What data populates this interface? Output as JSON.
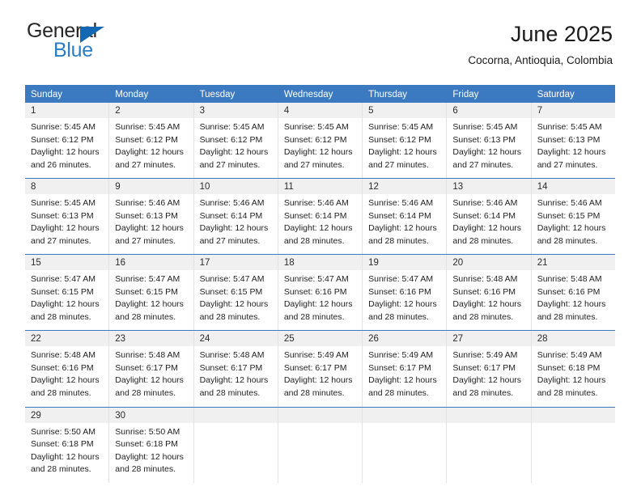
{
  "brand": {
    "name_top": "General",
    "name_bottom": "Blue",
    "triangle_icon": "triangle-logo-icon",
    "color_dark": "#262626",
    "color_blue": "#2a7dc4"
  },
  "header": {
    "title": "June 2025",
    "subtitle": "Cocorna, Antioquia, Colombia"
  },
  "theme": {
    "header_bg": "#3b7ac0",
    "header_text": "#ffffff",
    "daynum_bg": "#f0f0f0",
    "cell_bg": "#ffffff",
    "grid_line": "#e2e2e2",
    "week_divider": "#3b7ac0"
  },
  "calendar": {
    "weekdays": [
      "Sunday",
      "Monday",
      "Tuesday",
      "Wednesday",
      "Thursday",
      "Friday",
      "Saturday"
    ],
    "weeks": [
      {
        "days": [
          {
            "date": "1",
            "sunrise": "Sunrise: 5:45 AM",
            "sunset": "Sunset: 6:12 PM",
            "daylight_1": "Daylight: 12 hours",
            "daylight_2": "and 26 minutes."
          },
          {
            "date": "2",
            "sunrise": "Sunrise: 5:45 AM",
            "sunset": "Sunset: 6:12 PM",
            "daylight_1": "Daylight: 12 hours",
            "daylight_2": "and 27 minutes."
          },
          {
            "date": "3",
            "sunrise": "Sunrise: 5:45 AM",
            "sunset": "Sunset: 6:12 PM",
            "daylight_1": "Daylight: 12 hours",
            "daylight_2": "and 27 minutes."
          },
          {
            "date": "4",
            "sunrise": "Sunrise: 5:45 AM",
            "sunset": "Sunset: 6:12 PM",
            "daylight_1": "Daylight: 12 hours",
            "daylight_2": "and 27 minutes."
          },
          {
            "date": "5",
            "sunrise": "Sunrise: 5:45 AM",
            "sunset": "Sunset: 6:12 PM",
            "daylight_1": "Daylight: 12 hours",
            "daylight_2": "and 27 minutes."
          },
          {
            "date": "6",
            "sunrise": "Sunrise: 5:45 AM",
            "sunset": "Sunset: 6:13 PM",
            "daylight_1": "Daylight: 12 hours",
            "daylight_2": "and 27 minutes."
          },
          {
            "date": "7",
            "sunrise": "Sunrise: 5:45 AM",
            "sunset": "Sunset: 6:13 PM",
            "daylight_1": "Daylight: 12 hours",
            "daylight_2": "and 27 minutes."
          }
        ]
      },
      {
        "days": [
          {
            "date": "8",
            "sunrise": "Sunrise: 5:45 AM",
            "sunset": "Sunset: 6:13 PM",
            "daylight_1": "Daylight: 12 hours",
            "daylight_2": "and 27 minutes."
          },
          {
            "date": "9",
            "sunrise": "Sunrise: 5:46 AM",
            "sunset": "Sunset: 6:13 PM",
            "daylight_1": "Daylight: 12 hours",
            "daylight_2": "and 27 minutes."
          },
          {
            "date": "10",
            "sunrise": "Sunrise: 5:46 AM",
            "sunset": "Sunset: 6:14 PM",
            "daylight_1": "Daylight: 12 hours",
            "daylight_2": "and 27 minutes."
          },
          {
            "date": "11",
            "sunrise": "Sunrise: 5:46 AM",
            "sunset": "Sunset: 6:14 PM",
            "daylight_1": "Daylight: 12 hours",
            "daylight_2": "and 28 minutes."
          },
          {
            "date": "12",
            "sunrise": "Sunrise: 5:46 AM",
            "sunset": "Sunset: 6:14 PM",
            "daylight_1": "Daylight: 12 hours",
            "daylight_2": "and 28 minutes."
          },
          {
            "date": "13",
            "sunrise": "Sunrise: 5:46 AM",
            "sunset": "Sunset: 6:14 PM",
            "daylight_1": "Daylight: 12 hours",
            "daylight_2": "and 28 minutes."
          },
          {
            "date": "14",
            "sunrise": "Sunrise: 5:46 AM",
            "sunset": "Sunset: 6:15 PM",
            "daylight_1": "Daylight: 12 hours",
            "daylight_2": "and 28 minutes."
          }
        ]
      },
      {
        "days": [
          {
            "date": "15",
            "sunrise": "Sunrise: 5:47 AM",
            "sunset": "Sunset: 6:15 PM",
            "daylight_1": "Daylight: 12 hours",
            "daylight_2": "and 28 minutes."
          },
          {
            "date": "16",
            "sunrise": "Sunrise: 5:47 AM",
            "sunset": "Sunset: 6:15 PM",
            "daylight_1": "Daylight: 12 hours",
            "daylight_2": "and 28 minutes."
          },
          {
            "date": "17",
            "sunrise": "Sunrise: 5:47 AM",
            "sunset": "Sunset: 6:15 PM",
            "daylight_1": "Daylight: 12 hours",
            "daylight_2": "and 28 minutes."
          },
          {
            "date": "18",
            "sunrise": "Sunrise: 5:47 AM",
            "sunset": "Sunset: 6:16 PM",
            "daylight_1": "Daylight: 12 hours",
            "daylight_2": "and 28 minutes."
          },
          {
            "date": "19",
            "sunrise": "Sunrise: 5:47 AM",
            "sunset": "Sunset: 6:16 PM",
            "daylight_1": "Daylight: 12 hours",
            "daylight_2": "and 28 minutes."
          },
          {
            "date": "20",
            "sunrise": "Sunrise: 5:48 AM",
            "sunset": "Sunset: 6:16 PM",
            "daylight_1": "Daylight: 12 hours",
            "daylight_2": "and 28 minutes."
          },
          {
            "date": "21",
            "sunrise": "Sunrise: 5:48 AM",
            "sunset": "Sunset: 6:16 PM",
            "daylight_1": "Daylight: 12 hours",
            "daylight_2": "and 28 minutes."
          }
        ]
      },
      {
        "days": [
          {
            "date": "22",
            "sunrise": "Sunrise: 5:48 AM",
            "sunset": "Sunset: 6:16 PM",
            "daylight_1": "Daylight: 12 hours",
            "daylight_2": "and 28 minutes."
          },
          {
            "date": "23",
            "sunrise": "Sunrise: 5:48 AM",
            "sunset": "Sunset: 6:17 PM",
            "daylight_1": "Daylight: 12 hours",
            "daylight_2": "and 28 minutes."
          },
          {
            "date": "24",
            "sunrise": "Sunrise: 5:48 AM",
            "sunset": "Sunset: 6:17 PM",
            "daylight_1": "Daylight: 12 hours",
            "daylight_2": "and 28 minutes."
          },
          {
            "date": "25",
            "sunrise": "Sunrise: 5:49 AM",
            "sunset": "Sunset: 6:17 PM",
            "daylight_1": "Daylight: 12 hours",
            "daylight_2": "and 28 minutes."
          },
          {
            "date": "26",
            "sunrise": "Sunrise: 5:49 AM",
            "sunset": "Sunset: 6:17 PM",
            "daylight_1": "Daylight: 12 hours",
            "daylight_2": "and 28 minutes."
          },
          {
            "date": "27",
            "sunrise": "Sunrise: 5:49 AM",
            "sunset": "Sunset: 6:17 PM",
            "daylight_1": "Daylight: 12 hours",
            "daylight_2": "and 28 minutes."
          },
          {
            "date": "28",
            "sunrise": "Sunrise: 5:49 AM",
            "sunset": "Sunset: 6:18 PM",
            "daylight_1": "Daylight: 12 hours",
            "daylight_2": "and 28 minutes."
          }
        ]
      },
      {
        "days": [
          {
            "date": "29",
            "sunrise": "Sunrise: 5:50 AM",
            "sunset": "Sunset: 6:18 PM",
            "daylight_1": "Daylight: 12 hours",
            "daylight_2": "and 28 minutes."
          },
          {
            "date": "30",
            "sunrise": "Sunrise: 5:50 AM",
            "sunset": "Sunset: 6:18 PM",
            "daylight_1": "Daylight: 12 hours",
            "daylight_2": "and 28 minutes."
          },
          {
            "date": "",
            "sunrise": "",
            "sunset": "",
            "daylight_1": "",
            "daylight_2": ""
          },
          {
            "date": "",
            "sunrise": "",
            "sunset": "",
            "daylight_1": "",
            "daylight_2": ""
          },
          {
            "date": "",
            "sunrise": "",
            "sunset": "",
            "daylight_1": "",
            "daylight_2": ""
          },
          {
            "date": "",
            "sunrise": "",
            "sunset": "",
            "daylight_1": "",
            "daylight_2": ""
          },
          {
            "date": "",
            "sunrise": "",
            "sunset": "",
            "daylight_1": "",
            "daylight_2": ""
          }
        ]
      }
    ]
  }
}
